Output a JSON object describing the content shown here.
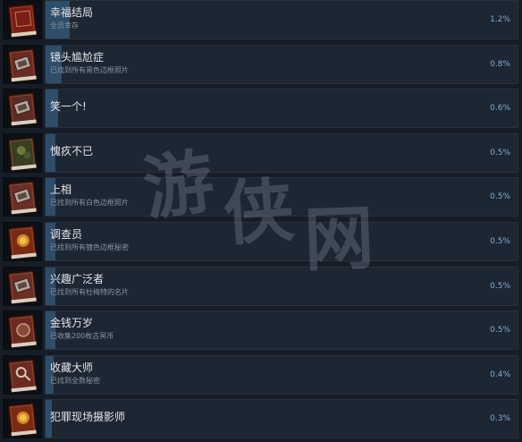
{
  "achievements": [
    {
      "title": "幸福结局",
      "desc": "全员幸存",
      "pct": "1.2%",
      "progress": 0.012,
      "icon": "red-book-icon",
      "color": "#7a1d14"
    },
    {
      "title": "镜头尴尬症",
      "desc": "已找到所有黑色边框照片",
      "pct": "0.8%",
      "progress": 0.008,
      "icon": "photo-book-icon",
      "color": "#6a2a22"
    },
    {
      "title": "笑一个!",
      "desc": "",
      "pct": "0.6%",
      "progress": 0.006,
      "icon": "photo-book-icon",
      "color": "#5d2a24"
    },
    {
      "title": "愧疚不已",
      "desc": "",
      "pct": "0.5%",
      "progress": 0.005,
      "icon": "green-book-icon",
      "color": "#3a3d22"
    },
    {
      "title": "上相",
      "desc": "已找到所有白色边框照片",
      "pct": "0.5%",
      "progress": 0.005,
      "icon": "photo-book-icon",
      "color": "#6a2e26"
    },
    {
      "title": "调查员",
      "desc": "已找到所有镀色边框秘密",
      "pct": "0.5%",
      "progress": 0.005,
      "icon": "gold-book-icon",
      "color": "#7a2a14"
    },
    {
      "title": "兴趣广泛者",
      "desc": "已找到所有杜梅特的名片",
      "pct": "0.5%",
      "progress": 0.005,
      "icon": "card-book-icon",
      "color": "#6a2e26"
    },
    {
      "title": "金钱万岁",
      "desc": "已收集200枚古冥币",
      "pct": "0.5%",
      "progress": 0.005,
      "icon": "coin-book-icon",
      "color": "#6a2a22"
    },
    {
      "title": "收藏大师",
      "desc": "已找到全数秘密",
      "pct": "0.4%",
      "progress": 0.004,
      "icon": "magnifier-book-icon",
      "color": "#6a2a22"
    },
    {
      "title": "犯罪现场摄影师",
      "desc": "",
      "pct": "0.3%",
      "progress": 0.003,
      "icon": "gold-book-icon",
      "color": "#7a2a14"
    }
  ],
  "watermark": "游侠网"
}
